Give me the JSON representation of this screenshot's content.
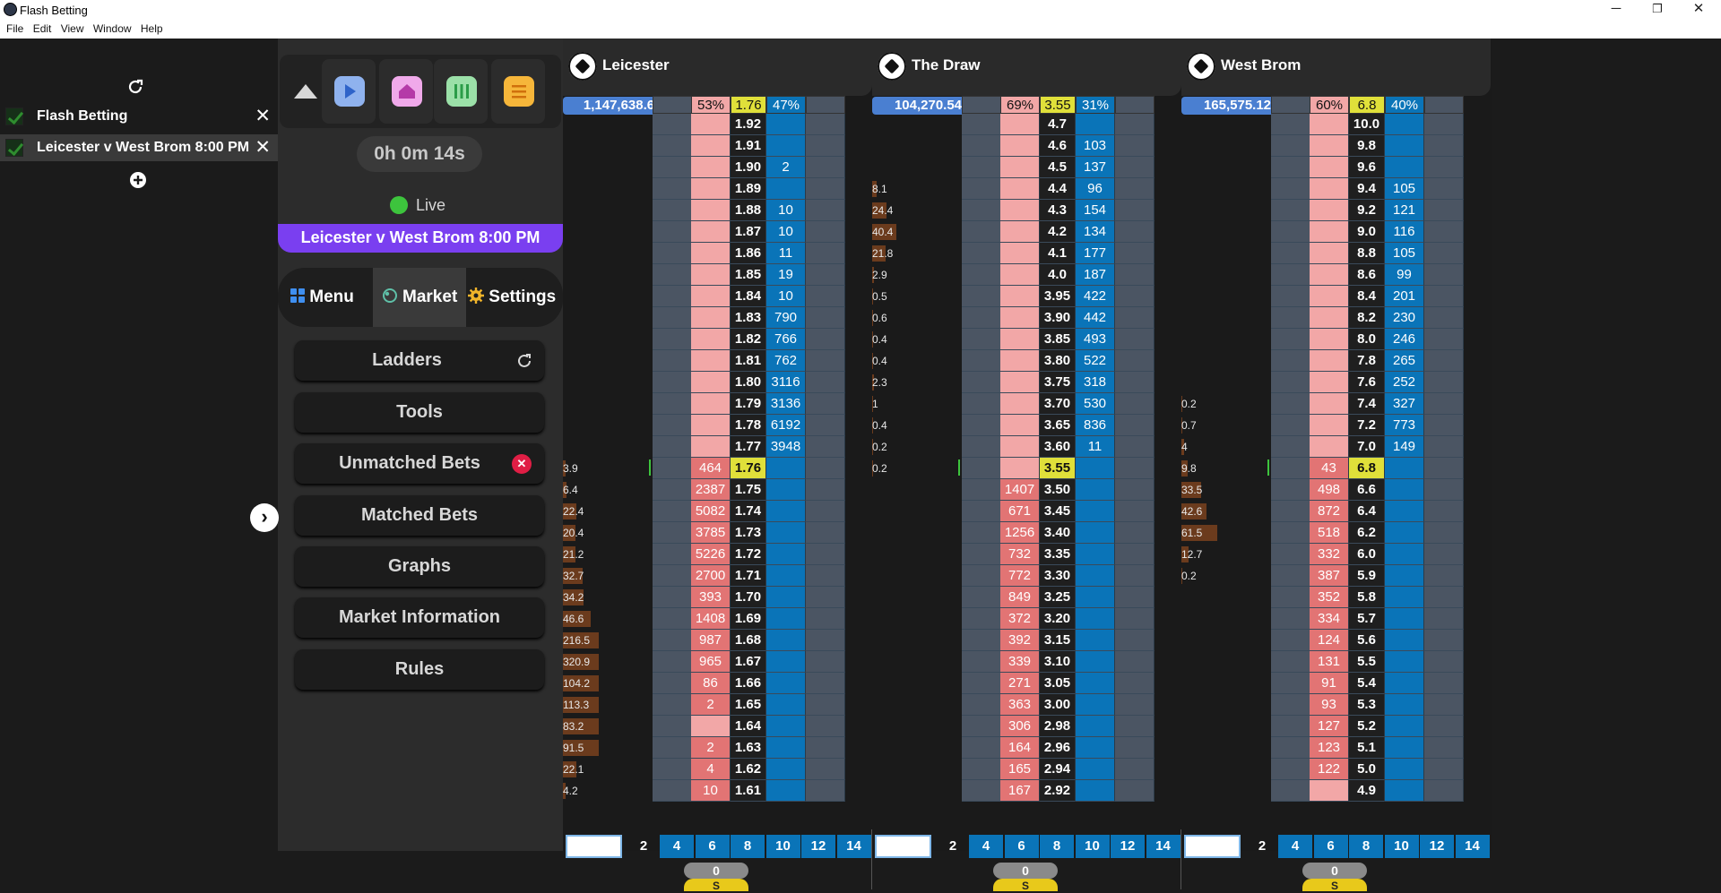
{
  "window": {
    "title": "Flash Betting",
    "minimize": "─",
    "maximize": "❐",
    "close": "✕"
  },
  "menu": [
    "File",
    "Edit",
    "View",
    "Window",
    "Help"
  ],
  "tree": {
    "items": [
      {
        "label": "Flash Betting"
      },
      {
        "label": "Leicester v West Brom 8:00 PM"
      }
    ]
  },
  "timer": "0h 0m 14s",
  "status": "Live",
  "event_title": "Leicester v West Brom 8:00 PM",
  "tabs": {
    "menu": "Menu",
    "market": "Market",
    "settings": "Settings"
  },
  "nav": {
    "ladders": "Ladders",
    "tools": "Tools",
    "unmatched": "Unmatched Bets",
    "matched": "Matched Bets",
    "graphs": "Graphs",
    "market_info": "Market Information",
    "rules": "Rules"
  },
  "colors": {
    "accent": "#7a3ff0",
    "back": "#0a74b8",
    "lay": "#f2a7a7",
    "ltp": "#e0e03a",
    "live": "#3dc43d"
  },
  "footer_steps": [
    "2",
    "4",
    "6",
    "8",
    "10",
    "12",
    "14"
  ],
  "footer_zero": "0",
  "footer_s": "S",
  "markets": [
    {
      "name": "Leicester",
      "volume": "1,147,638.6",
      "lay_pct": "53%",
      "ltp": "1.76",
      "back_pct": "47%",
      "ltp_row": 16,
      "prices": [
        "1.92",
        "1.91",
        "1.90",
        "1.89",
        "1.88",
        "1.87",
        "1.86",
        "1.85",
        "1.84",
        "1.83",
        "1.82",
        "1.81",
        "1.80",
        "1.79",
        "1.78",
        "1.77",
        "1.76",
        "1.75",
        "1.74",
        "1.73",
        "1.72",
        "1.71",
        "1.70",
        "1.69",
        "1.68",
        "1.67",
        "1.66",
        "1.65",
        "1.64",
        "1.63",
        "1.62",
        "1.61"
      ],
      "back": [
        "",
        "",
        "2",
        "",
        "10",
        "10",
        "11",
        "19",
        "10",
        "790",
        "766",
        "762",
        "3116",
        "3136",
        "6192",
        "3948",
        "",
        "",
        "",
        "",
        "",
        "",
        "",
        "",
        "",
        "",
        "",
        "",
        "",
        "",
        "",
        ""
      ],
      "lay": [
        "",
        "",
        "",
        "",
        "",
        "",
        "",
        "",
        "",
        "",
        "",
        "",
        "",
        "",
        "",
        "",
        "464",
        "2387",
        "5082",
        "3785",
        "5226",
        "2700",
        "393",
        "1408",
        "987",
        "965",
        "86",
        "2",
        "",
        "2",
        "4",
        "10"
      ],
      "traded": [
        "",
        "",
        "",
        "",
        "",
        "",
        "",
        "",
        "",
        "",
        "",
        "",
        "",
        "",
        "",
        "",
        "3.9",
        "6.4",
        "22.4",
        "20.4",
        "21.2",
        "32.7",
        "34.2",
        "46.6",
        "216.5",
        "320.9",
        "104.2",
        "113.3",
        "83.2",
        "91.5",
        "22.1",
        "4.2"
      ]
    },
    {
      "name": "The Draw",
      "volume": "104,270.54",
      "lay_pct": "69%",
      "ltp": "3.55",
      "back_pct": "31%",
      "ltp_row": 16,
      "prices": [
        "4.7",
        "4.6",
        "4.5",
        "4.4",
        "4.3",
        "4.2",
        "4.1",
        "4.0",
        "3.95",
        "3.90",
        "3.85",
        "3.80",
        "3.75",
        "3.70",
        "3.65",
        "3.60",
        "3.55",
        "3.50",
        "3.45",
        "3.40",
        "3.35",
        "3.30",
        "3.25",
        "3.20",
        "3.15",
        "3.10",
        "3.05",
        "3.00",
        "2.98",
        "2.96",
        "2.94",
        "2.92"
      ],
      "back": [
        "",
        "103",
        "137",
        "96",
        "154",
        "134",
        "177",
        "187",
        "422",
        "442",
        "493",
        "522",
        "318",
        "530",
        "836",
        "11",
        "",
        "",
        "",
        "",
        "",
        "",
        "",
        "",
        "",
        "",
        "",
        "",
        "",
        "",
        "",
        ""
      ],
      "lay": [
        "",
        "",
        "",
        "",
        "",
        "",
        "",
        "",
        "",
        "",
        "",
        "",
        "",
        "",
        "",
        "",
        "",
        "1407",
        "671",
        "1256",
        "732",
        "772",
        "849",
        "372",
        "392",
        "339",
        "271",
        "363",
        "306",
        "164",
        "165",
        "167"
      ],
      "traded": [
        "",
        "",
        "",
        "8.1",
        "24.4",
        "40.4",
        "21.8",
        "2.9",
        "0.5",
        "0.6",
        "0.4",
        "0.4",
        "2.3",
        "1",
        "0.4",
        "0.2",
        "0.2",
        "",
        "",
        "",
        "",
        "",
        "",
        "",
        "",
        "",
        "",
        "",
        "",
        "",
        "",
        ""
      ]
    },
    {
      "name": "West Brom",
      "volume": "165,575.12",
      "lay_pct": "60%",
      "ltp": "6.8",
      "back_pct": "40%",
      "ltp_row": 16,
      "prices": [
        "10.0",
        "9.8",
        "9.6",
        "9.4",
        "9.2",
        "9.0",
        "8.8",
        "8.6",
        "8.4",
        "8.2",
        "8.0",
        "7.8",
        "7.6",
        "7.4",
        "7.2",
        "7.0",
        "6.8",
        "6.6",
        "6.4",
        "6.2",
        "6.0",
        "5.9",
        "5.8",
        "5.7",
        "5.6",
        "5.5",
        "5.4",
        "5.3",
        "5.2",
        "5.1",
        "5.0",
        "4.9"
      ],
      "back": [
        "",
        "",
        "",
        "105",
        "121",
        "116",
        "105",
        "99",
        "201",
        "230",
        "246",
        "265",
        "252",
        "327",
        "773",
        "149",
        "",
        "",
        "",
        "",
        "",
        "",
        "",
        "",
        "",
        "",
        "",
        "",
        "",
        "",
        "",
        ""
      ],
      "lay": [
        "",
        "",
        "",
        "",
        "",
        "",
        "",
        "",
        "",
        "",
        "",
        "",
        "",
        "",
        "",
        "",
        "43",
        "498",
        "872",
        "518",
        "332",
        "387",
        "352",
        "334",
        "124",
        "131",
        "91",
        "93",
        "127",
        "123",
        "122",
        ""
      ],
      "traded": [
        "",
        "",
        "",
        "",
        "",
        "",
        "",
        "",
        "",
        "",
        "",
        "",
        "",
        "0.2",
        "0.7",
        "4",
        "9.8",
        "33.5",
        "42.6",
        "61.5",
        "12.7",
        "0.2",
        "",
        "",
        "",
        "",
        "",
        "",
        "",
        "",
        "",
        ""
      ]
    }
  ]
}
